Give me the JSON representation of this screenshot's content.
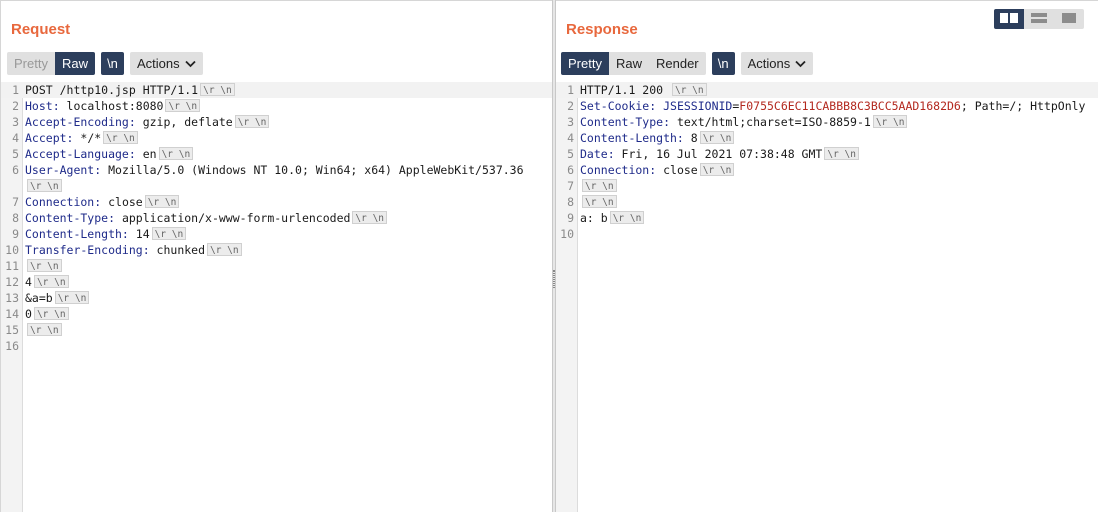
{
  "request": {
    "title": "Request",
    "view_buttons": [
      {
        "label": "Pretty",
        "state": "disabled"
      },
      {
        "label": "Raw",
        "state": "active"
      }
    ],
    "newline_label": "\\n",
    "actions_label": "Actions",
    "lines": [
      {
        "num": "1",
        "segments": [
          {
            "t": "POST /http10.jsp HTTP/1.1"
          }
        ],
        "crlf": "\\r \\n",
        "hl": true
      },
      {
        "num": "2",
        "segments": [
          {
            "t": "Host:",
            "c": "hn"
          },
          {
            "t": " localhost:8080"
          }
        ],
        "crlf": "\\r \\n"
      },
      {
        "num": "3",
        "segments": [
          {
            "t": "Accept-Encoding:",
            "c": "hn"
          },
          {
            "t": " gzip, deflate"
          }
        ],
        "crlf": "\\r \\n"
      },
      {
        "num": "4",
        "segments": [
          {
            "t": "Accept:",
            "c": "hn"
          },
          {
            "t": " */*"
          }
        ],
        "crlf": "\\r \\n"
      },
      {
        "num": "5",
        "segments": [
          {
            "t": "Accept-Language:",
            "c": "hn"
          },
          {
            "t": " en"
          }
        ],
        "crlf": "\\r \\n"
      },
      {
        "num": "6",
        "segments": [
          {
            "t": "User-Agent:",
            "c": "hn"
          },
          {
            "t": " Mozilla/5.0 (Windows NT 10.0; Win64; x64) AppleWebKit/537.36"
          }
        ],
        "crlf": ""
      },
      {
        "num": "",
        "segments": [],
        "crlf": "\\r \\n"
      },
      {
        "num": "7",
        "segments": [
          {
            "t": "Connection:",
            "c": "hn"
          },
          {
            "t": " close"
          }
        ],
        "crlf": "\\r \\n"
      },
      {
        "num": "8",
        "segments": [
          {
            "t": "Content-Type:",
            "c": "hn"
          },
          {
            "t": " application/x-www-form-urlencoded"
          }
        ],
        "crlf": "\\r \\n"
      },
      {
        "num": "9",
        "segments": [
          {
            "t": "Content-Length:",
            "c": "hn"
          },
          {
            "t": " 14"
          }
        ],
        "crlf": "\\r \\n"
      },
      {
        "num": "10",
        "segments": [
          {
            "t": "Transfer-Encoding:",
            "c": "hn"
          },
          {
            "t": " chunked"
          }
        ],
        "crlf": "\\r \\n"
      },
      {
        "num": "11",
        "segments": [],
        "crlf": "\\r \\n"
      },
      {
        "num": "12",
        "segments": [
          {
            "t": "4"
          }
        ],
        "crlf": "\\r \\n"
      },
      {
        "num": "13",
        "segments": [
          {
            "t": "&a=b"
          }
        ],
        "crlf": "\\r \\n"
      },
      {
        "num": "14",
        "segments": [
          {
            "t": "0"
          }
        ],
        "crlf": "\\r \\n"
      },
      {
        "num": "15",
        "segments": [],
        "crlf": "\\r \\n"
      },
      {
        "num": "16",
        "segments": [],
        "crlf": ""
      }
    ]
  },
  "response": {
    "title": "Response",
    "view_buttons": [
      {
        "label": "Pretty",
        "state": "active"
      },
      {
        "label": "Raw",
        "state": "normal"
      },
      {
        "label": "Render",
        "state": "normal"
      }
    ],
    "newline_label": "\\n",
    "actions_label": "Actions",
    "lines": [
      {
        "num": "1",
        "segments": [
          {
            "t": "HTTP/1.1 200 "
          }
        ],
        "crlf": "\\r \\n",
        "hl": true
      },
      {
        "num": "2",
        "segments": [
          {
            "t": "Set-Cookie:",
            "c": "hn"
          },
          {
            "t": " "
          },
          {
            "t": "JSESSIONID",
            "c": "hn"
          },
          {
            "t": "="
          },
          {
            "t": "F0755C6EC11CABBB8C3BCC5AAD1682D6",
            "c": "sid"
          },
          {
            "t": "; Path=/; HttpOnly"
          }
        ],
        "crlf": ""
      },
      {
        "num": "3",
        "segments": [
          {
            "t": "Content-Type:",
            "c": "hn"
          },
          {
            "t": " text/html;charset=ISO-8859-1"
          }
        ],
        "crlf": "\\r \\n"
      },
      {
        "num": "4",
        "segments": [
          {
            "t": "Content-Length:",
            "c": "hn"
          },
          {
            "t": " 8"
          }
        ],
        "crlf": "\\r \\n"
      },
      {
        "num": "5",
        "segments": [
          {
            "t": "Date:",
            "c": "hn"
          },
          {
            "t": " Fri, 16 Jul 2021 07:38:48 GMT"
          }
        ],
        "crlf": "\\r \\n"
      },
      {
        "num": "6",
        "segments": [
          {
            "t": "Connection:",
            "c": "hn"
          },
          {
            "t": " close"
          }
        ],
        "crlf": "\\r \\n"
      },
      {
        "num": "7",
        "segments": [],
        "crlf": "\\r \\n"
      },
      {
        "num": "8",
        "segments": [],
        "crlf": "\\r \\n"
      },
      {
        "num": "9",
        "segments": [
          {
            "t": "a: b"
          }
        ],
        "crlf": "\\r \\n"
      },
      {
        "num": "10",
        "segments": [],
        "crlf": ""
      }
    ]
  },
  "layout_toggle": [
    {
      "icon": "split-horizontal-icon",
      "state": "active"
    },
    {
      "icon": "split-vertical-icon",
      "state": "normal"
    },
    {
      "icon": "tabs-icon",
      "state": "normal"
    }
  ],
  "colors": {
    "accent_title": "#e8683d",
    "active_button": "#2c3e5c",
    "header_name": "#1f2b8a",
    "session_id": "#b3291f"
  }
}
